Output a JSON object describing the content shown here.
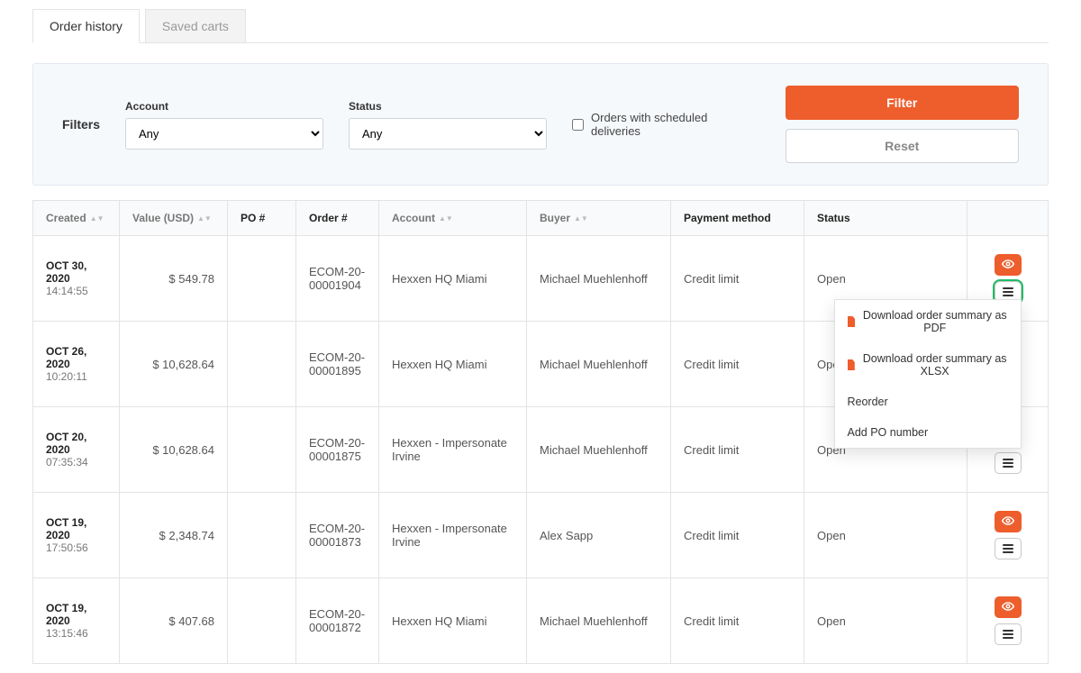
{
  "tabs": {
    "active": "Order history",
    "inactive": "Saved carts"
  },
  "filters": {
    "title": "Filters",
    "account_label": "Account",
    "account_value": "Any",
    "status_label": "Status",
    "status_value": "Any",
    "scheduled_label": "Orders with scheduled deliveries",
    "filter_btn": "Filter",
    "reset_btn": "Reset"
  },
  "columns": {
    "created": "Created",
    "value": "Value (USD)",
    "po": "PO #",
    "order": "Order #",
    "account": "Account",
    "buyer": "Buyer",
    "payment": "Payment method",
    "status": "Status"
  },
  "dropdown": {
    "pdf": "Download order summary as PDF",
    "xlsx": "Download order summary as XLSX",
    "reorder": "Reorder",
    "add_po": "Add PO number"
  },
  "orders": [
    {
      "date": "OCT 30, 2020",
      "time": "14:14:55",
      "value": "$ 549.78",
      "order": "ECOM-20-00001904",
      "account": "Hexxen HQ Miami",
      "buyer": "Michael Muehlenhoff",
      "payment": "Credit limit",
      "status": "Open"
    },
    {
      "date": "OCT 26, 2020",
      "time": "10:20:11",
      "value": "$ 10,628.64",
      "order": "ECOM-20-00001895",
      "account": "Hexxen HQ Miami",
      "buyer": "Michael Muehlenhoff",
      "payment": "Credit limit",
      "status": "Open"
    },
    {
      "date": "OCT 20, 2020",
      "time": "07:35:34",
      "value": "$ 10,628.64",
      "order": "ECOM-20-00001875",
      "account": "Hexxen - Impersonate Irvine",
      "buyer": "Michael Muehlenhoff",
      "payment": "Credit limit",
      "status": "Open"
    },
    {
      "date": "OCT 19, 2020",
      "time": "17:50:56",
      "value": "$ 2,348.74",
      "order": "ECOM-20-00001873",
      "account": "Hexxen - Impersonate Irvine",
      "buyer": "Alex Sapp",
      "payment": "Credit limit",
      "status": "Open"
    },
    {
      "date": "OCT 19, 2020",
      "time": "13:15:46",
      "value": "$ 407.68",
      "order": "ECOM-20-00001872",
      "account": "Hexxen HQ Miami",
      "buyer": "Michael Muehlenhoff",
      "payment": "Credit limit",
      "status": "Open"
    }
  ]
}
